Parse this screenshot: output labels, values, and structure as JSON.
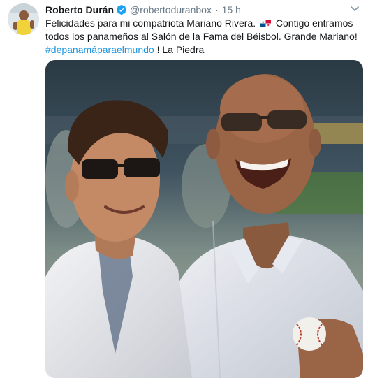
{
  "tweet": {
    "author": {
      "name": "Roberto Durán",
      "handle": "@robertoduranbox",
      "verified": true,
      "avatar_icon": "person-avatar"
    },
    "separator": "·",
    "time": "15 h",
    "text_part1": "Felicidades para mi compatriota Mariano Rivera. ",
    "flag_icon": "panama-flag-icon",
    "text_part2": " Contigo entramos todos los panameños al Salón de la Fama del Béisbol. Grande Mariano! ",
    "hashtag": "#depanamáparaelmundo",
    "text_part3": " ! La Piedra",
    "image_description_icon": "photo-two-men-smiling",
    "colors": {
      "link": "#1b95e0",
      "verified": "#1da1f2",
      "secondary_text": "#657786",
      "primary_text": "#14171a"
    }
  }
}
